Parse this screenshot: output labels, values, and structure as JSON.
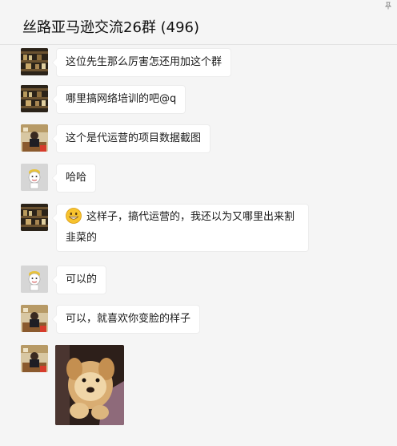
{
  "header": {
    "title": "丝路亚马逊交流26群 (496)"
  },
  "messages": [
    {
      "avatar": "dark-shelf-avatar",
      "text": "这位先生那么厉害怎还用加这个群"
    },
    {
      "avatar": "dark-shelf-avatar",
      "text": "哪里搞网络培训的吧@q"
    },
    {
      "avatar": "office-person-avatar",
      "text": "这个是代运营的项目数据截图"
    },
    {
      "avatar": "cartoon-chef-avatar",
      "text": "哈哈"
    },
    {
      "avatar": "dark-shelf-avatar",
      "emoji": "grinning-face-emoji",
      "text": "这样子，搞代运营的，我还以为又哪里出来割韭菜的"
    },
    {
      "avatar": "cartoon-chef-avatar",
      "text": "可以的"
    },
    {
      "avatar": "office-person-avatar",
      "text": "可以，就喜欢你变脸的样子"
    },
    {
      "avatar": "office-person-avatar",
      "image": "puppy-photo"
    }
  ],
  "colors": {
    "background": "#f5f5f5",
    "bubble": "#ffffff",
    "bubble_border": "#ececec"
  }
}
